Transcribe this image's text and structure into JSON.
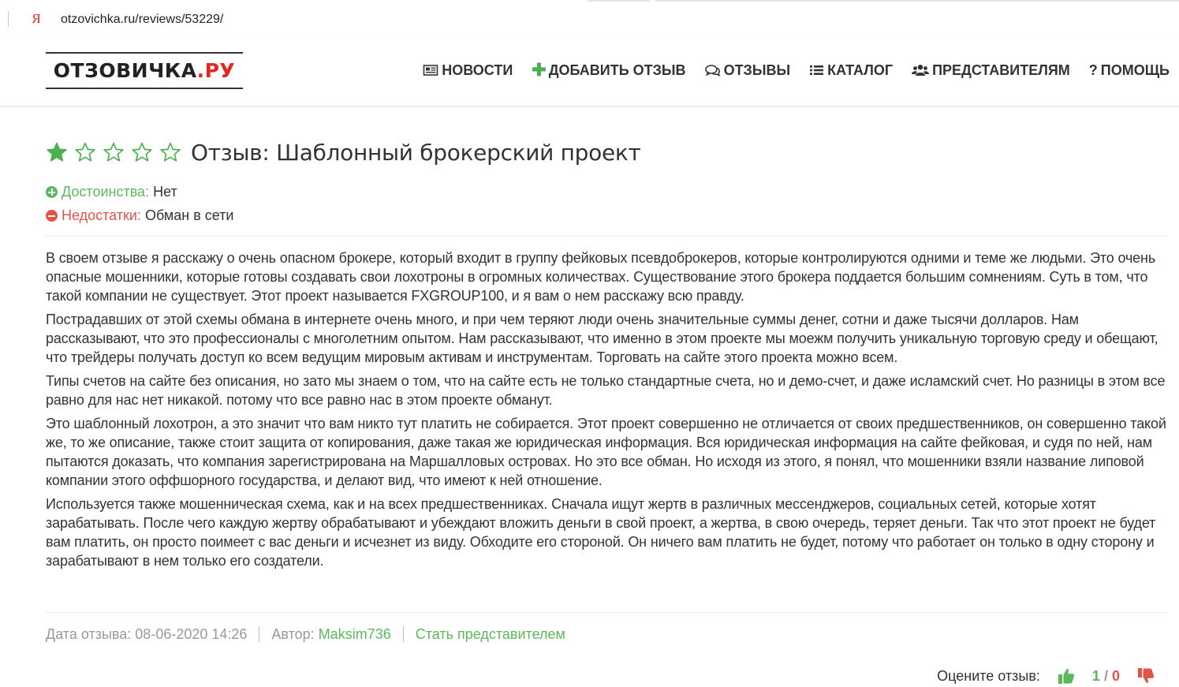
{
  "browser": {
    "url": "otzovichka.ru/reviews/53229/",
    "site_icon": "yandex-icon",
    "site_icon_glyph": "Я"
  },
  "header": {
    "logo": {
      "part1": "ОТЗОВИЧКА",
      "part2": ".РУ"
    },
    "nav": [
      {
        "icon": "newspaper-icon",
        "label": "НОВОСТИ"
      },
      {
        "icon": "plus-icon",
        "label": "ДОБАВИТЬ ОТЗЫВ"
      },
      {
        "icon": "comments-icon",
        "label": "ОТЗЫВЫ"
      },
      {
        "icon": "list-icon",
        "label": "КАТАЛОГ"
      },
      {
        "icon": "users-icon",
        "label": "ПРЕДСТАВИТЕЛЯМ"
      },
      {
        "icon": "question-icon",
        "label": "ПОМОЩЬ",
        "glyph": "?"
      }
    ]
  },
  "review": {
    "rating": 1,
    "rating_max": 5,
    "title": "Отзыв: Шаблонный брокерский проект",
    "pros_label": "Достоинства:",
    "pros_value": "Нет",
    "cons_label": "Недостатки:",
    "cons_value": "Обман в сети",
    "paragraphs": [
      "В своем отзыве я расскажу о очень опасном брокере, который входит в группу фейковых псевдоброкеров, которые контролируются одними и теме же людьми. Это очень опасные мошенники, которые готовы создавать свои лохотроны в огромных количествах. Существование этого брокера поддается большим сомнениям. Суть в том, что такой компании не существует. Этот проект называется FXGROUP100, и я вам о нем расскажу всю правду.",
      "Пострадавших от этой схемы обмана в интернете очень много, и при чем теряют люди очень значительные суммы денег, сотни и даже тысячи долларов. Нам рассказывают, что это профессионалы с многолетним опытом. Нам рассказывают, что именно в этом проекте мы моежм получить уникальную торговую среду и обещают, что трейдеры получать доступ ко всем ведущим мировым активам и инструментам. Торговать на сайте этого проекта можно всем.",
      "Типы счетов на сайте без описания, но зато мы знаем о том, что на сайте есть не только стандартные счета, но и демо-счет, и даже исламский счет. Но разницы в этом все равно для нас нет никакой. потому что все равно нас в этом проекте обманут.",
      "Это шаблонный лохотрон, а это значит что вам никто тут платить не собирается. Этот проект совершенно не отличается от своих предшественников, он совершенно такой же, то же описание, также стоит защита от копирования, даже такая же юридическая информация. Вся юридическая информация на сайте фейковая, и судя по ней, нам пытаются доказать, что компания зарегистрирована на Маршалловых островах. Но это все обман. Но исходя из этого, я понял, что мошенники взяли название липовой компании этого оффшорного государства, и делают вид, что имеют к ней отношение.",
      "Используется также мошенническая схема, как и на всех предшественниках. Сначала ищут жертв в различных мессенджеров, социальных сетей, которые хотят зарабатывать. После чего каждую жертву обрабатывают и убеждают вложить деньги в свой проект, а жертва, в свою очередь, теряет деньги. Так что этот проект не будет вам платить, он просто поимеет с вас деньги и исчезнет из виду. Обходите его стороной. Он ничего вам платить не будет, потому что работает он только в одну сторону и зарабатывают в нем только его создатели."
    ],
    "meta": {
      "date_label": "Дата отзыва:",
      "date_value": "08-06-2020 14:26",
      "author_label": "Автор:",
      "author_name": "Maksim736",
      "become_rep": "Стать представителем"
    },
    "vote": {
      "label": "Оцените отзыв:",
      "up": "1",
      "separator": "/",
      "down": "0"
    }
  },
  "colors": {
    "accent_green": "#5cb85c",
    "accent_red": "#e05547",
    "logo_red": "#e52620",
    "star_green": "#4caf50"
  }
}
